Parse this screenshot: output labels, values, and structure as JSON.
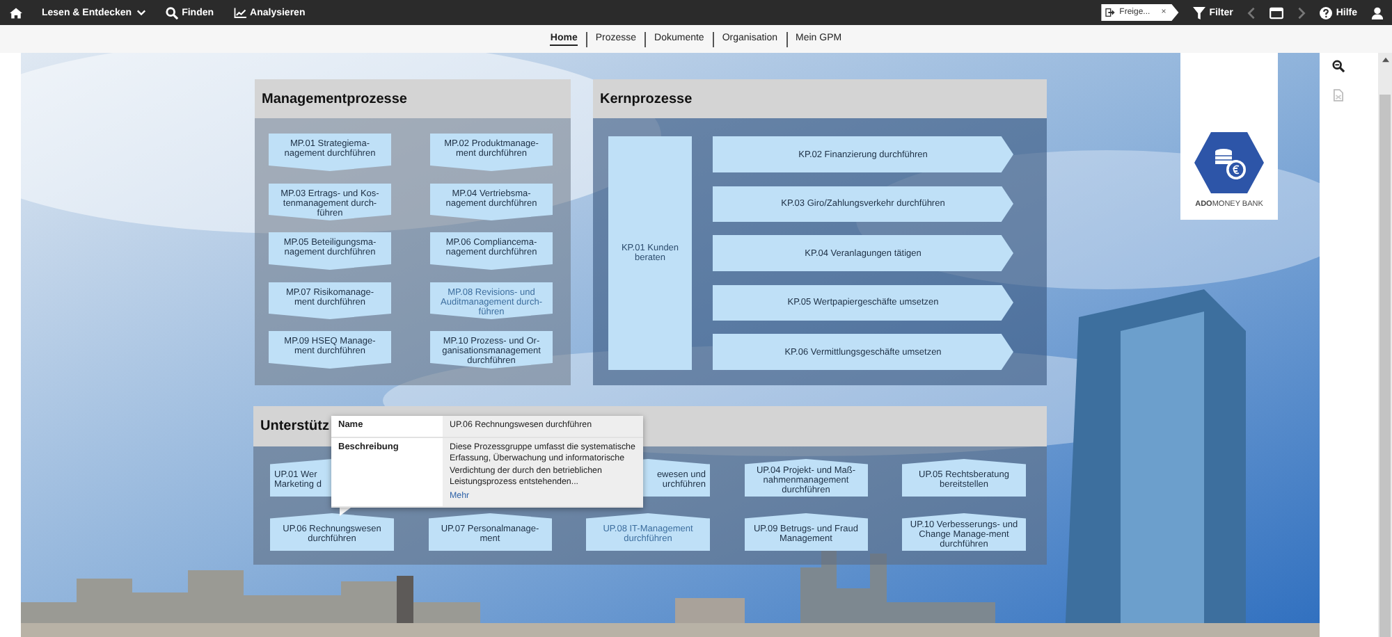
{
  "topbar": {
    "menu": [
      {
        "label": "Lesen & Entdecken",
        "kind": "dropdown"
      },
      {
        "label": "Finden",
        "kind": "search"
      },
      {
        "label": "Analysieren",
        "kind": "chart"
      }
    ],
    "chip": {
      "label": "Freige...",
      "close": "×"
    },
    "filter": "Filter",
    "nav_buttons": [
      {
        "kind": "prev",
        "disabled": true
      },
      {
        "kind": "window",
        "disabled": false
      },
      {
        "kind": "next",
        "disabled": true
      }
    ],
    "help": "Hilfe"
  },
  "tabs": [
    {
      "label": "Home",
      "selected": true
    },
    {
      "label": "Prozesse",
      "selected": false
    },
    {
      "label": "Dokumente",
      "selected": false
    },
    {
      "label": "Organisation",
      "selected": false
    },
    {
      "label": "Mein GPM",
      "selected": false
    }
  ],
  "management": {
    "title": "Managementprozesse",
    "items": [
      {
        "text": "MP.01 Strategiema-nagement durchführen",
        "highlighted": false
      },
      {
        "text": "MP.02 Produktmanage-ment durchführen",
        "highlighted": false
      },
      {
        "text": "MP.03 Ertrags- und Kos-tenmanagement durch-führen",
        "highlighted": false
      },
      {
        "text": "MP.04 Vertriebsma-nagement durchführen",
        "highlighted": false
      },
      {
        "text": "MP.05 Beteiligungsma-nagement durchführen",
        "highlighted": false
      },
      {
        "text": "MP.06 Compliancema-nagement durchführen",
        "highlighted": false
      },
      {
        "text": "MP.07 Risikomanage-ment durchführen",
        "highlighted": false
      },
      {
        "text": "MP.08 Revisions- und Auditmanagement durch-führen",
        "highlighted": true
      },
      {
        "text": "MP.09 HSEQ Manage-ment durchführen",
        "highlighted": false
      },
      {
        "text": "MP.10 Prozess- und Or-ganisationsmanagement durchführen",
        "highlighted": false
      }
    ]
  },
  "core": {
    "title": "Kernprozesse",
    "main": "KP.01 Kunden beraten",
    "items": [
      "KP.02 Finanzierung durchführen",
      "KP.03 Giro/Zahlungsverkehr durchführen",
      "KP.04 Veranlagungen tätigen",
      "KP.05 Wertpapiergeschäfte umsetzen",
      "KP.06 Vermittlungsgeschäfte umsetzen"
    ]
  },
  "support": {
    "title": "Unterstütz",
    "rows": [
      [
        {
          "text": "UP.01 Wer Marketing d",
          "highlighted": false
        },
        null,
        {
          "text": "ewesen und urchführen",
          "highlighted": false
        },
        {
          "text": "UP.04 Projekt- und Maß-nahmenmanagement durchführen",
          "highlighted": false
        },
        {
          "text": "UP.05 Rechtsberatung bereitstellen",
          "highlighted": false
        }
      ],
      [
        {
          "text": "UP.06 Rechnungswesen durchführen",
          "highlighted": false
        },
        {
          "text": "UP.07 Personalmanage-ment",
          "highlighted": false
        },
        {
          "text": "UP.08 IT-Management durchführen",
          "highlighted": true
        },
        {
          "text": "UP.09 Betrugs- und Fraud Management",
          "highlighted": false
        },
        {
          "text": "UP.10 Verbesserungs- und Change Manage-ment durchführen",
          "highlighted": false
        }
      ]
    ]
  },
  "tooltip": {
    "rows": [
      {
        "label": "Name",
        "value": "UP.06 Rechnungswesen durchführen"
      },
      {
        "label": "Beschreibung",
        "value": "Diese Prozessgruppe umfasst die systematische Erfassung, Überwachung und informatorische Verdichtung der durch den betrieblichen Leistungsprozess entstehenden..."
      }
    ],
    "link": "Mehr"
  },
  "logo": {
    "text": "**ADO**MONEY BANK"
  }
}
